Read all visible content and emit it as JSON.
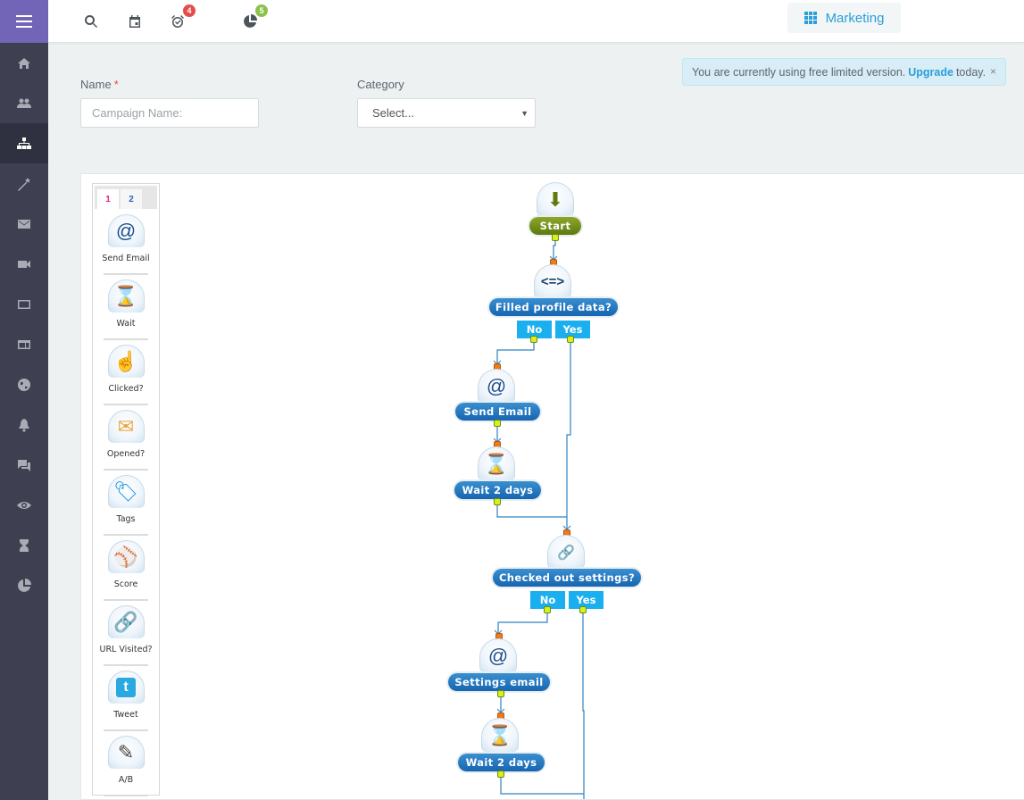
{
  "header": {
    "badges": {
      "reminders": "4",
      "stats": "5"
    },
    "module_label": "Marketing"
  },
  "sidebar": {
    "items": [
      {
        "name": "home",
        "icon": "home-icon"
      },
      {
        "name": "contacts",
        "icon": "users-icon"
      },
      {
        "name": "campaigns",
        "icon": "sitemap-icon",
        "active": true
      },
      {
        "name": "tools",
        "icon": "magic-wand-icon"
      },
      {
        "name": "email",
        "icon": "envelope-icon"
      },
      {
        "name": "video",
        "icon": "video-icon"
      },
      {
        "name": "popups",
        "icon": "window-icon"
      },
      {
        "name": "forms",
        "icon": "form-icon"
      },
      {
        "name": "web",
        "icon": "globe-icon"
      },
      {
        "name": "notifications",
        "icon": "bell-icon"
      },
      {
        "name": "chat",
        "icon": "chat-icon"
      },
      {
        "name": "visitors",
        "icon": "eye-icon"
      },
      {
        "name": "timers",
        "icon": "hourglass-icon"
      },
      {
        "name": "reports",
        "icon": "pie-chart-icon"
      }
    ]
  },
  "alert": {
    "text_before": "You are currently using free limited version.",
    "link": "Upgrade",
    "text_after": "today.",
    "close": "×"
  },
  "form": {
    "name_label": "Name",
    "name_required": "*",
    "name_placeholder": "Campaign Name:",
    "category_label": "Category",
    "category_value": "Select...",
    "category_caret": "▼"
  },
  "palette": {
    "tabs": [
      "1",
      "2"
    ],
    "items": [
      {
        "label": "Send Email",
        "icon": "@"
      },
      {
        "label": "Wait",
        "icon": "⌛"
      },
      {
        "label": "Clicked?",
        "icon": "☝"
      },
      {
        "label": "Opened?",
        "icon": "✉"
      },
      {
        "label": "Tags",
        "icon": "🏷"
      },
      {
        "label": "Score",
        "icon": "⚾"
      },
      {
        "label": "URL Visited?",
        "icon": "🔗"
      },
      {
        "label": "Tweet",
        "icon": "t"
      },
      {
        "label": "A/B",
        "icon": "✎"
      }
    ]
  },
  "flow": {
    "start": {
      "label": "Start",
      "icon": "⬇"
    },
    "cond1": {
      "label": "Filled profile data?",
      "icon": "<=>",
      "no": "No",
      "yes": "Yes"
    },
    "send1": {
      "label": "Send Email",
      "icon": "@"
    },
    "wait1": {
      "label": "Wait 2 days",
      "icon": "⌛"
    },
    "cond2": {
      "label": "Checked out settings?",
      "icon": "🔗",
      "no": "No",
      "yes": "Yes"
    },
    "send2": {
      "label": "Settings email",
      "icon": "@"
    },
    "wait2": {
      "label": "Wait 2 days",
      "icon": "⌛"
    }
  }
}
